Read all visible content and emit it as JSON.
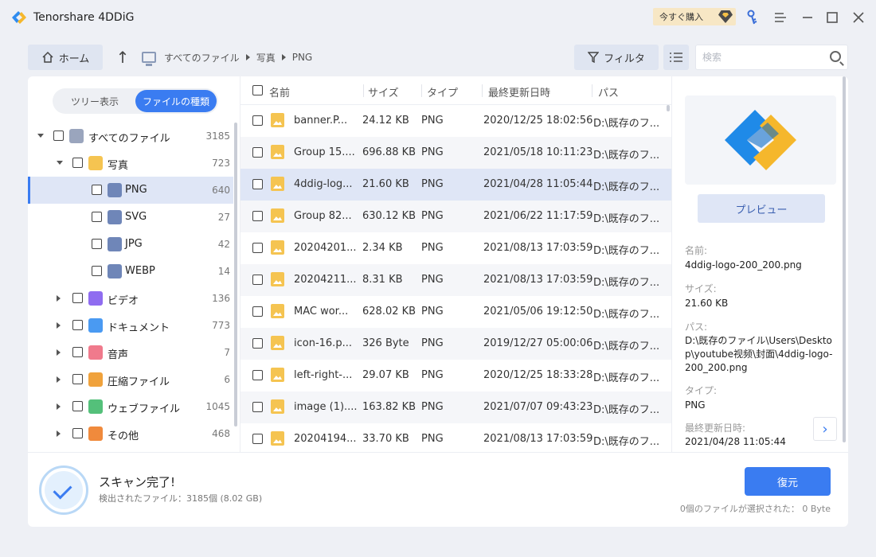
{
  "app": {
    "title": "Tenorshare 4DDiG",
    "buy_label": "今すぐ購入"
  },
  "toolbar": {
    "home_label": "ホーム",
    "breadcrumb": [
      "すべてのファイル",
      "写真",
      "PNG"
    ],
    "filter_label": "フィルタ",
    "search_placeholder": "検索"
  },
  "view_tabs": [
    "ツリー表示",
    "ファイルの種類"
  ],
  "tree": [
    {
      "label": "すべてのファイル",
      "count": "3185",
      "icon": "computer-icon",
      "color": "#9aa5bd",
      "level": 0,
      "caret": "down"
    },
    {
      "label": "写真",
      "count": "723",
      "icon": "photo-icon",
      "color": "#f5c451",
      "level": 1,
      "caret": "down"
    },
    {
      "label": "PNG",
      "count": "640",
      "icon": "folder-icon",
      "color": "#6f86b8",
      "level": 2,
      "caret": "",
      "selected": true
    },
    {
      "label": "SVG",
      "count": "27",
      "icon": "folder-icon",
      "color": "#6f86b8",
      "level": 2,
      "caret": ""
    },
    {
      "label": "JPG",
      "count": "42",
      "icon": "folder-icon",
      "color": "#6f86b8",
      "level": 2,
      "caret": ""
    },
    {
      "label": "WEBP",
      "count": "14",
      "icon": "folder-icon",
      "color": "#6f86b8",
      "level": 2,
      "caret": ""
    },
    {
      "label": "ビデオ",
      "count": "136",
      "icon": "video-icon",
      "color": "#8f6cf0",
      "level": 1,
      "caret": "right"
    },
    {
      "label": "ドキュメント",
      "count": "773",
      "icon": "document-icon",
      "color": "#4a9af2",
      "level": 1,
      "caret": "right"
    },
    {
      "label": "音声",
      "count": "7",
      "icon": "audio-icon",
      "color": "#f07a8c",
      "level": 1,
      "caret": "right"
    },
    {
      "label": "圧縮ファイル",
      "count": "6",
      "icon": "archive-icon",
      "color": "#f0a23c",
      "level": 1,
      "caret": "right"
    },
    {
      "label": "ウェブファイル",
      "count": "1045",
      "icon": "web-icon",
      "color": "#54c07a",
      "level": 1,
      "caret": "right"
    },
    {
      "label": "その他",
      "count": "468",
      "icon": "other-icon",
      "color": "#f08a3c",
      "level": 1,
      "caret": "right"
    }
  ],
  "table": {
    "headers": [
      "名前",
      "サイズ",
      "タイプ",
      "最終更新日時",
      "パス"
    ],
    "rows": [
      {
        "name": "banner.P...",
        "size": "24.12 KB",
        "type": "PNG",
        "date": "2020/12/25 18:02:56",
        "path": "D:\\既存のフ..."
      },
      {
        "name": "Group 15....",
        "size": "696.88 KB",
        "type": "PNG",
        "date": "2021/05/18 10:11:23",
        "path": "D:\\既存のフ..."
      },
      {
        "name": "4ddig-log...",
        "size": "21.60 KB",
        "type": "PNG",
        "date": "2021/04/28 11:05:44",
        "path": "D:\\既存のフ...",
        "selected": true
      },
      {
        "name": "Group 82...",
        "size": "630.12 KB",
        "type": "PNG",
        "date": "2021/06/22 11:17:59",
        "path": "D:\\既存のフ..."
      },
      {
        "name": "20204201...",
        "size": "2.34 KB",
        "type": "PNG",
        "date": "2021/08/13 17:03:59",
        "path": "D:\\既存のフ..."
      },
      {
        "name": "20204211...",
        "size": "8.31 KB",
        "type": "PNG",
        "date": "2021/08/13 17:03:59",
        "path": "D:\\既存のフ..."
      },
      {
        "name": "MAC wor...",
        "size": "628.02 KB",
        "type": "PNG",
        "date": "2021/05/06 19:12:50",
        "path": "D:\\既存のフ..."
      },
      {
        "name": "icon-16.p...",
        "size": "326 Byte",
        "type": "PNG",
        "date": "2019/12/27 05:00:06",
        "path": "D:\\既存のフ..."
      },
      {
        "name": "left-right-...",
        "size": "29.07 KB",
        "type": "PNG",
        "date": "2020/12/25 18:33:28",
        "path": "D:\\既存のフ..."
      },
      {
        "name": "image (1)....",
        "size": "163.82 KB",
        "type": "PNG",
        "date": "2021/07/07 09:43:23",
        "path": "D:\\既存のフ..."
      },
      {
        "name": "20204194...",
        "size": "33.70 KB",
        "type": "PNG",
        "date": "2021/08/13 17:03:59",
        "path": "D:\\既存のフ..."
      }
    ]
  },
  "details": {
    "preview_label": "プレビュー",
    "name_label": "名前:",
    "name_value": "4ddig-logo-200_200.png",
    "size_label": "サイズ:",
    "size_value": "21.60 KB",
    "path_label": "パス:",
    "path_value": "D:\\既存のファイル\\Users\\Desktop\\youtube视频\\封面\\4ddig-logo-200_200.png",
    "type_label": "タイプ:",
    "type_value": "PNG",
    "date_label": "最終更新日時:",
    "date_value": "2021/04/28 11:05:44"
  },
  "footer": {
    "scan_done": "スキャン完了!",
    "found_files": "検出されたファイル：3185個 (8.02 GB)",
    "recover_label": "復元",
    "selected_info": "0個のファイルが選択された：  0 Byte"
  },
  "colors": {
    "accent": "#3a7cf1",
    "selected_row": "#dfe6f6",
    "buy_bg": "#f7e7c5"
  }
}
